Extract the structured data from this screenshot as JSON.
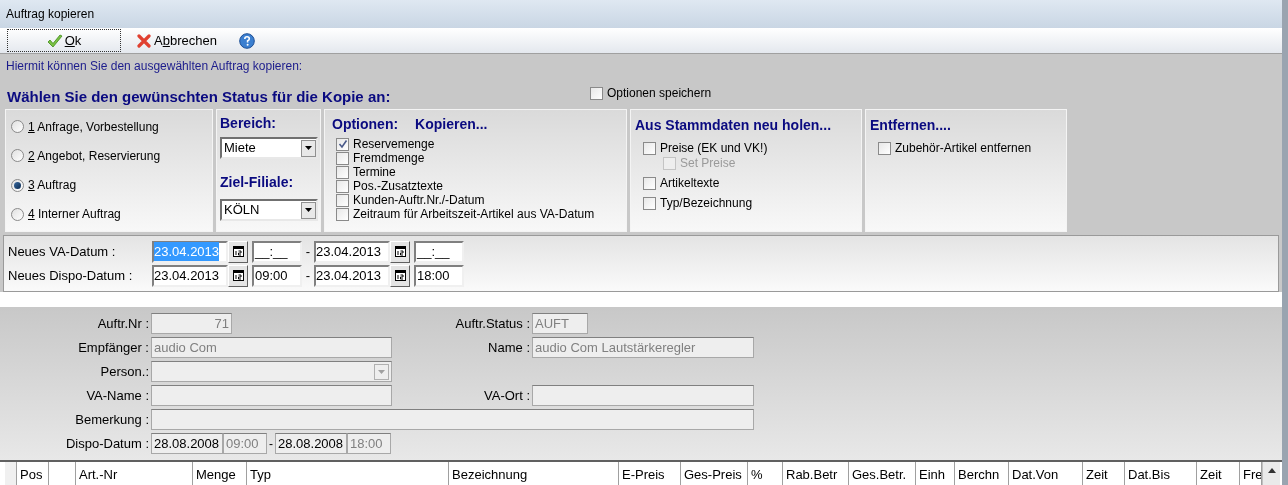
{
  "window": {
    "title": "Auftrag kopieren"
  },
  "toolbar": [
    {
      "kind": "ok",
      "key": "O",
      "after": "k"
    },
    {
      "kind": "cancel",
      "before": "A",
      "key": "b",
      "after": "brechen"
    },
    {
      "kind": "help"
    }
  ],
  "info": "Hiermit können Sie den ausgewählten Auftrag kopieren:",
  "heading": "Wählen Sie den gewünschten Status für die Kopie an:",
  "save_options": {
    "label": "Optionen speichern",
    "checked": false
  },
  "status_options": [
    {
      "key": "1",
      "after": " Anfrage, Vorbestellung",
      "selected": false
    },
    {
      "key": "2",
      "after": " Angebot, Reservierung",
      "selected": false
    },
    {
      "key": "3",
      "after": " Auftrag",
      "selected": true
    },
    {
      "key": "4",
      "after": " Interner Auftrag",
      "selected": false
    }
  ],
  "bereich": {
    "label": "Bereich:",
    "value": "Miete"
  },
  "ziel_filiale": {
    "label": "Ziel-Filiale:",
    "value": "KÖLN"
  },
  "optionen": {
    "title": "Optionen:",
    "subtitle": "Kopieren...",
    "items": [
      {
        "label": "Reservemenge",
        "checked": true
      },
      {
        "label": "Fremdmenge",
        "checked": false
      },
      {
        "label": "Termine",
        "checked": false
      },
      {
        "label": "Pos.-Zusatztexte",
        "checked": false
      },
      {
        "label": "Kunden-Auftr.Nr./-Datum",
        "checked": false
      },
      {
        "label": "Zeitraum für Arbeitszeit-Artikel aus VA-Datum",
        "checked": false
      }
    ]
  },
  "stammdaten": {
    "title": "Aus Stammdaten neu holen...",
    "items": [
      {
        "label": "Preise (EK und VK!)",
        "checked": false,
        "disabled": false,
        "children": [
          {
            "label": "Set Preise",
            "checked": false,
            "disabled": true
          }
        ]
      },
      {
        "label": "Artikeltexte",
        "checked": false,
        "disabled": false
      },
      {
        "label": "Typ/Bezeichnung",
        "checked": false,
        "disabled": false
      }
    ]
  },
  "entfernen": {
    "title": "Entfernen....",
    "items": [
      {
        "label": "Zubehör-Artikel entfernen",
        "checked": false
      }
    ]
  },
  "new_dates": [
    {
      "label": "Neues VA-Datum :",
      "separator": "-",
      "fields": [
        {
          "kind": "date",
          "value": "23.04.2013",
          "selected": true
        },
        {
          "kind": "time",
          "value": "__:__",
          "selected": false
        },
        {
          "kind": "date",
          "value": "23.04.2013",
          "selected": false
        },
        {
          "kind": "time",
          "value": "__:__",
          "selected": false
        }
      ]
    },
    {
      "label": "Neues Dispo-Datum :",
      "separator": "-",
      "fields": [
        {
          "kind": "date",
          "value": "23.04.2013",
          "selected": false
        },
        {
          "kind": "time",
          "value": "09:00",
          "selected": false
        },
        {
          "kind": "date",
          "value": "23.04.2013",
          "selected": false
        },
        {
          "kind": "time",
          "value": "18:00",
          "selected": false
        }
      ]
    }
  ],
  "order": {
    "auftr_nr": {
      "label": "Auftr.Nr :",
      "value": "71"
    },
    "auftr_status": {
      "label": "Auftr.Status :",
      "value": "AUFT"
    },
    "empfaenger": {
      "label": "Empfänger :",
      "value": "audio Com"
    },
    "name": {
      "label": "Name :",
      "value": "audio Com Lautstärkeregler"
    },
    "person": {
      "label": "Person.:"
    },
    "va_name": {
      "label": "VA-Name :"
    },
    "va_ort": {
      "label": "VA-Ort :"
    },
    "bemerkung": {
      "label": "Bemerkung :"
    },
    "dispo": {
      "label": "Dispo-Datum :",
      "from_date": "28.08.2008",
      "from_time": "09:00",
      "separator": "-",
      "to_date": "28.08.2008",
      "to_time": "18:00"
    }
  },
  "table": {
    "columns": [
      {
        "kind": "blank"
      },
      {
        "kind": "text",
        "label": "Pos"
      },
      {
        "kind": "blank"
      },
      {
        "kind": "text",
        "label": "Art.-Nr"
      },
      {
        "kind": "text",
        "label": "Menge"
      },
      {
        "kind": "text",
        "label": "Typ"
      },
      {
        "kind": "text",
        "label": "Bezeichnung"
      },
      {
        "kind": "text",
        "label": "E-Preis"
      },
      {
        "kind": "text",
        "label": "Ges-Preis"
      },
      {
        "kind": "text",
        "label": "%"
      },
      {
        "kind": "text",
        "label": "Rab.Betr"
      },
      {
        "kind": "text",
        "label": "Ges.Betr."
      },
      {
        "kind": "text",
        "label": "Einh"
      },
      {
        "kind": "text",
        "label": "Berchn"
      },
      {
        "kind": "text",
        "label": "Dat.Von"
      },
      {
        "kind": "text",
        "label": "Zeit"
      },
      {
        "kind": "text",
        "label": "Dat.Bis"
      },
      {
        "kind": "text",
        "label": "Zeit"
      },
      {
        "kind": "text",
        "label": "Fre"
      }
    ]
  }
}
